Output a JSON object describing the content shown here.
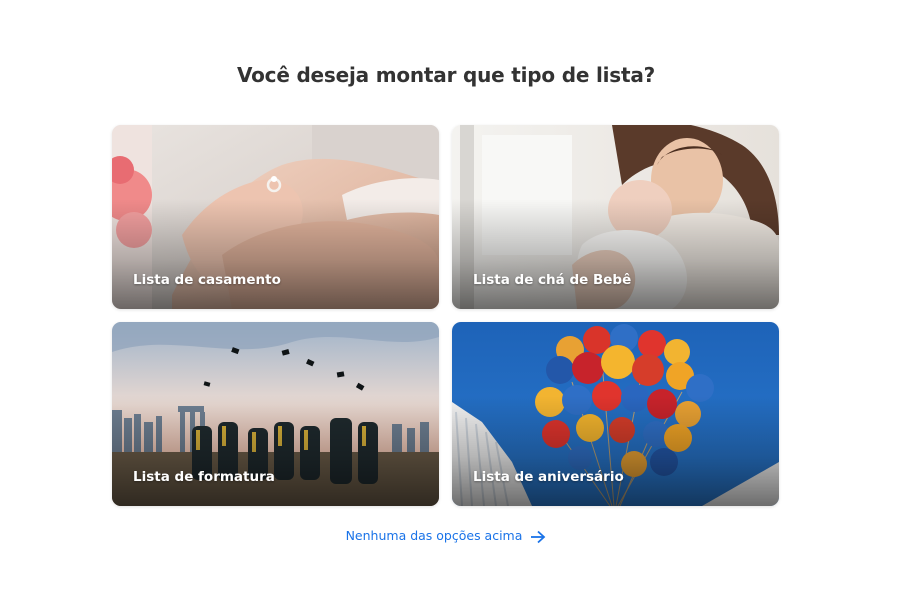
{
  "page": {
    "title": "Você deseja montar que tipo de lista?"
  },
  "cards": [
    {
      "label": "Lista de casamento",
      "image": "wedding-hands-ring-image"
    },
    {
      "label": "Lista de chá de Bebê",
      "image": "mother-baby-image"
    },
    {
      "label": "Lista de formatura",
      "image": "graduation-caps-image"
    },
    {
      "label": "Lista de aniversário",
      "image": "balloons-image"
    }
  ],
  "footer_link": {
    "label": "Nenhuma das opções acima",
    "icon": "arrow-right-icon"
  },
  "colors": {
    "accent": "#1a73e8",
    "title": "#333333",
    "card_label": "#ffffff"
  }
}
